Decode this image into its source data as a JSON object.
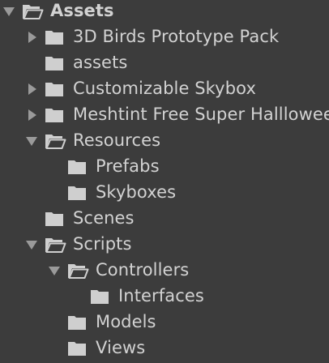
{
  "colors": {
    "background": "#3c3c3c",
    "text": "#d2d2d2",
    "folder_icon": "#cfcfcf",
    "arrow": "#9a9a9a"
  },
  "tree": {
    "items": [
      {
        "label": "Assets",
        "depth": 0,
        "expandable": true,
        "expanded": true,
        "icon": "folder-open-icon",
        "bold": true
      },
      {
        "label": "3D Birds Prototype Pack",
        "depth": 1,
        "expandable": true,
        "expanded": false,
        "icon": "folder-icon"
      },
      {
        "label": "assets",
        "depth": 1,
        "expandable": false,
        "expanded": false,
        "icon": "folder-icon"
      },
      {
        "label": "Customizable Skybox",
        "depth": 1,
        "expandable": true,
        "expanded": false,
        "icon": "folder-icon"
      },
      {
        "label": "Meshtint Free Super Hallloween",
        "depth": 1,
        "expandable": true,
        "expanded": false,
        "icon": "folder-icon"
      },
      {
        "label": "Resources",
        "depth": 1,
        "expandable": true,
        "expanded": true,
        "icon": "folder-open-icon"
      },
      {
        "label": "Prefabs",
        "depth": 2,
        "expandable": false,
        "expanded": false,
        "icon": "folder-icon"
      },
      {
        "label": "Skyboxes",
        "depth": 2,
        "expandable": false,
        "expanded": false,
        "icon": "folder-icon"
      },
      {
        "label": "Scenes",
        "depth": 1,
        "expandable": false,
        "expanded": false,
        "icon": "folder-icon"
      },
      {
        "label": "Scripts",
        "depth": 1,
        "expandable": true,
        "expanded": true,
        "icon": "folder-open-icon"
      },
      {
        "label": "Controllers",
        "depth": 2,
        "expandable": true,
        "expanded": true,
        "icon": "folder-open-icon"
      },
      {
        "label": "Interfaces",
        "depth": 3,
        "expandable": false,
        "expanded": false,
        "icon": "folder-icon"
      },
      {
        "label": "Models",
        "depth": 2,
        "expandable": false,
        "expanded": false,
        "icon": "folder-icon"
      },
      {
        "label": "Views",
        "depth": 2,
        "expandable": false,
        "expanded": false,
        "icon": "folder-icon"
      }
    ]
  }
}
